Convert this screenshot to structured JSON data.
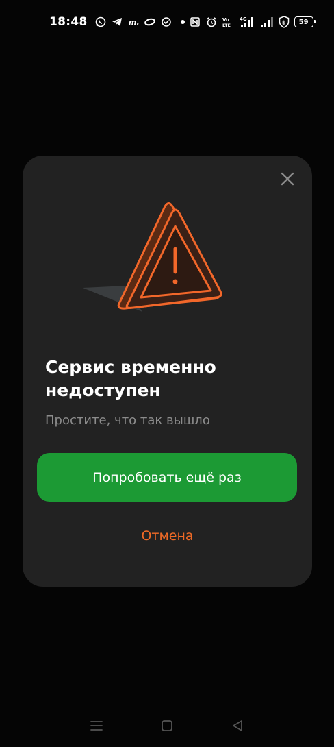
{
  "status_bar": {
    "time": "18:48",
    "battery": "59",
    "icons_left": [
      "whatsapp-icon",
      "telegram-icon",
      "m-icon",
      "infinity-icon",
      "check-circle-icon",
      "dot-icon"
    ],
    "icons_right": [
      "nfc-icon",
      "alarm-icon",
      "volte-icon",
      "signal-4g-icon",
      "signal-icon",
      "shield-dollar-icon",
      "battery-icon"
    ],
    "volte_text": "Vo LTE",
    "net_text": "4G"
  },
  "dialog": {
    "title": "Сервис временно недоступен",
    "subtitle": "Простите, что так вышло",
    "retry_label": "Попробовать ещё раз",
    "cancel_label": "Отмена",
    "close_icon": "close-icon",
    "illustration_icon": "warning-triangle-icon"
  },
  "nav_bar": {
    "icons": [
      "menu-icon",
      "home-icon",
      "back-icon"
    ]
  },
  "colors": {
    "background": "#050505",
    "card": "#222222",
    "accent_green": "#1c9a34",
    "accent_orange": "#f06a26",
    "subtitle_gray": "#8c8c8c"
  }
}
